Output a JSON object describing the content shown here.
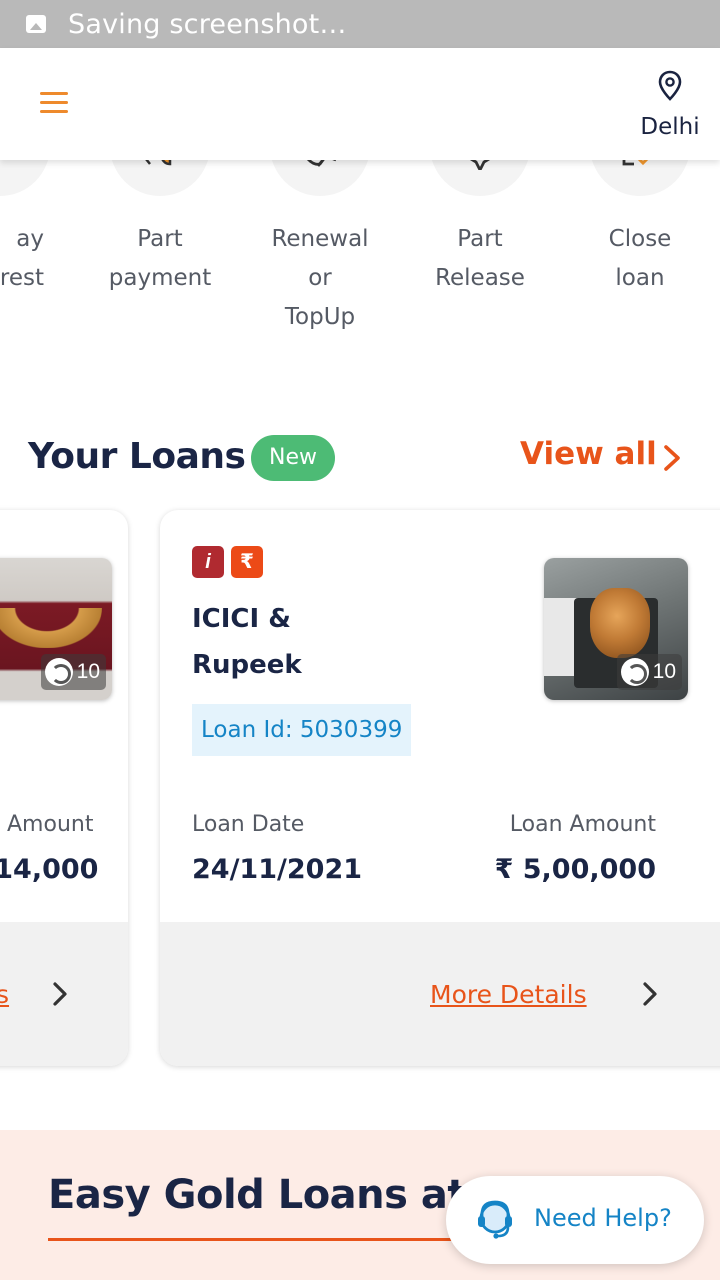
{
  "status_bar": {
    "text": "Saving screenshot…",
    "icon": "image-icon"
  },
  "header": {
    "menu_icon": "hamburger-icon",
    "location_icon": "map-pin-icon",
    "city": "Delhi",
    "accent": "#ee8a2c"
  },
  "quick_actions": [
    {
      "label": "ay\nrest",
      "icon": "pay-interest-icon"
    },
    {
      "label": "Part\npayment",
      "icon": "part-payment-icon"
    },
    {
      "label": "Renewal\nor\nTopUp",
      "icon": "renewal-icon"
    },
    {
      "label": "Part\nRelease",
      "icon": "part-release-icon"
    },
    {
      "label": "Close\nloan",
      "icon": "close-loan-icon"
    }
  ],
  "loans_section": {
    "title": "Your Loans",
    "badge": "New",
    "view_all": "View all",
    "accent": "#e8541a",
    "badge_color": "#4dbb75"
  },
  "loan_cards": [
    {
      "amount_label": "Amount",
      "amount": ",14,000",
      "gold_count": "10",
      "more_link": "s"
    },
    {
      "lenders": [
        "ICICI",
        "Rupeek"
      ],
      "lender_name_line1": "ICICI &",
      "lender_name_line2": "Rupeek",
      "loan_id": "Loan Id: 5030399",
      "gold_count": "10",
      "date_label": "Loan Date",
      "date": "24/11/2021",
      "amount_label": "Loan Amount",
      "amount": "₹ 5,00,000",
      "more_link": "More Details"
    }
  ],
  "promo": {
    "title": "Easy Gold Loans at"
  },
  "help": {
    "label": "Need Help?",
    "icon": "headset-icon",
    "color": "#1584c6"
  }
}
